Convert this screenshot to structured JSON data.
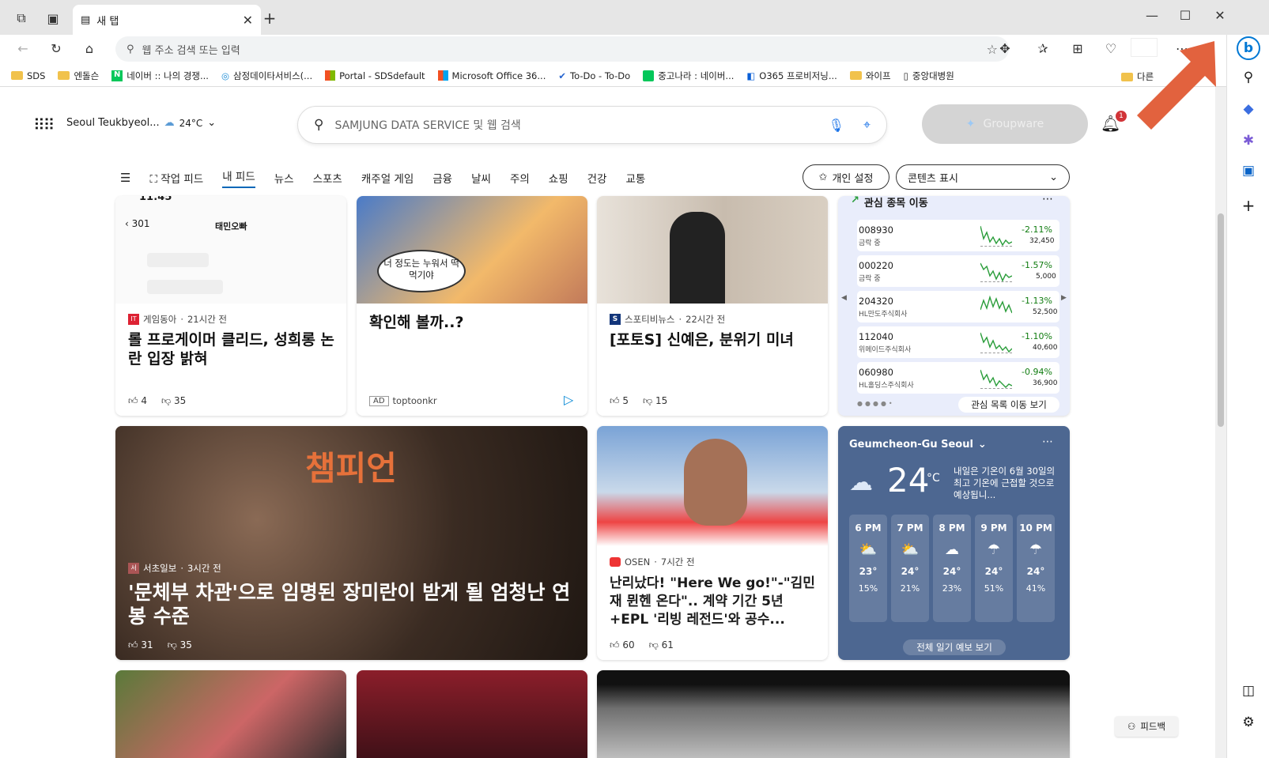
{
  "browser": {
    "tab_title": "새 탭",
    "address_placeholder": "웹 주소 검색 또는 입력",
    "bookmarks": [
      "SDS",
      "엔돌슨",
      "네이버 :: 나의 경쟁...",
      "삼정데이타서비스(...",
      "Portal - SDSdefault",
      "Microsoft Office 36...",
      "To-Do - To-Do",
      "중고나라 : 네이버...",
      "O365 프로비저닝...",
      "와이프",
      "중앙대병원",
      "다른"
    ]
  },
  "header": {
    "location": "Seoul Teukbyeol...",
    "temp": "24°C",
    "search_placeholder": "SAMJUNG DATA SERVICE 및 웹 검색",
    "groupware": "Groupware",
    "notif_count": "1"
  },
  "nav": {
    "items": [
      "작업 피드",
      "내 피드",
      "뉴스",
      "스포츠",
      "캐주얼 게임",
      "금융",
      "날씨",
      "주의",
      "쇼핑",
      "건강",
      "교통"
    ],
    "personalize": "개인 설정",
    "content_display": "콘텐츠 표시"
  },
  "cards": {
    "c1": {
      "source": "게임동아",
      "time": "21시간 전",
      "title": "롤 프로게이머 클리드, 성희롱 논란 입장 밝혀",
      "likes": "4",
      "dislikes": "35",
      "img_text": "11:45",
      "img_name": "태민오빠"
    },
    "c2": {
      "title": "확인해 볼까..?",
      "ad": "AD",
      "advertiser": "toptoonkr",
      "bubble": "너 정도는 누워서 떡 먹기야"
    },
    "c3": {
      "source": "스포티비뉴스",
      "time": "22시간 전",
      "title": "[포토S] 신예은, 분위기 미녀",
      "likes": "5",
      "dislikes": "15"
    },
    "c4": {
      "source": "서초일보",
      "time": "3시간 전",
      "title": "'문체부 차관'으로 임명된 장미란이 받게 될 엄청난 연봉 수준",
      "likes": "31",
      "dislikes": "35",
      "img_text": "챔피언"
    },
    "c5": {
      "source": "OSEN",
      "time": "7시간 전",
      "title": "난리났다! \"Here We go!\"-\"김민재 뮌헨 온다\".. 계약 기간 5년+EPL '리빙 레전드'와 공수...",
      "likes": "60",
      "dislikes": "61"
    }
  },
  "stocks": {
    "title": "관심 종목 이동",
    "footer": "관심 목록 이동 보기",
    "rows": [
      {
        "code": "008930",
        "name": "금락 중",
        "change": "-2.11%",
        "price": "32,450"
      },
      {
        "code": "000220",
        "name": "금락 중",
        "change": "-1.57%",
        "price": "5,000"
      },
      {
        "code": "204320",
        "name": "HL만도주식회사",
        "change": "-1.13%",
        "price": "52,500"
      },
      {
        "code": "112040",
        "name": "위메이드주식회사",
        "change": "-1.10%",
        "price": "40,600"
      },
      {
        "code": "060980",
        "name": "HL홀딩스주식회사",
        "change": "-0.94%",
        "price": "36,900"
      }
    ]
  },
  "weather": {
    "location": "Geumcheon-Gu Seoul",
    "temp": "24",
    "unit": "°C",
    "note": "내일은 기온이 6월 30일의 최고 기온에 근접할 것으로 예상됩니...",
    "hours": [
      {
        "time": "6 PM",
        "temp": "23°",
        "rain": "15%"
      },
      {
        "time": "7 PM",
        "temp": "24°",
        "rain": "21%"
      },
      {
        "time": "8 PM",
        "temp": "24°",
        "rain": "23%"
      },
      {
        "time": "9 PM",
        "temp": "24°",
        "rain": "51%"
      },
      {
        "time": "10 PM",
        "temp": "24°",
        "rain": "41%"
      }
    ],
    "footer": "전체 일기 예보 보기"
  },
  "feedback": "피드백",
  "colors": {
    "accent": "#0067b8",
    "arrow": "#e2623e",
    "weather_bg": "#4d6791",
    "stock_bg": "#e9edfb"
  }
}
